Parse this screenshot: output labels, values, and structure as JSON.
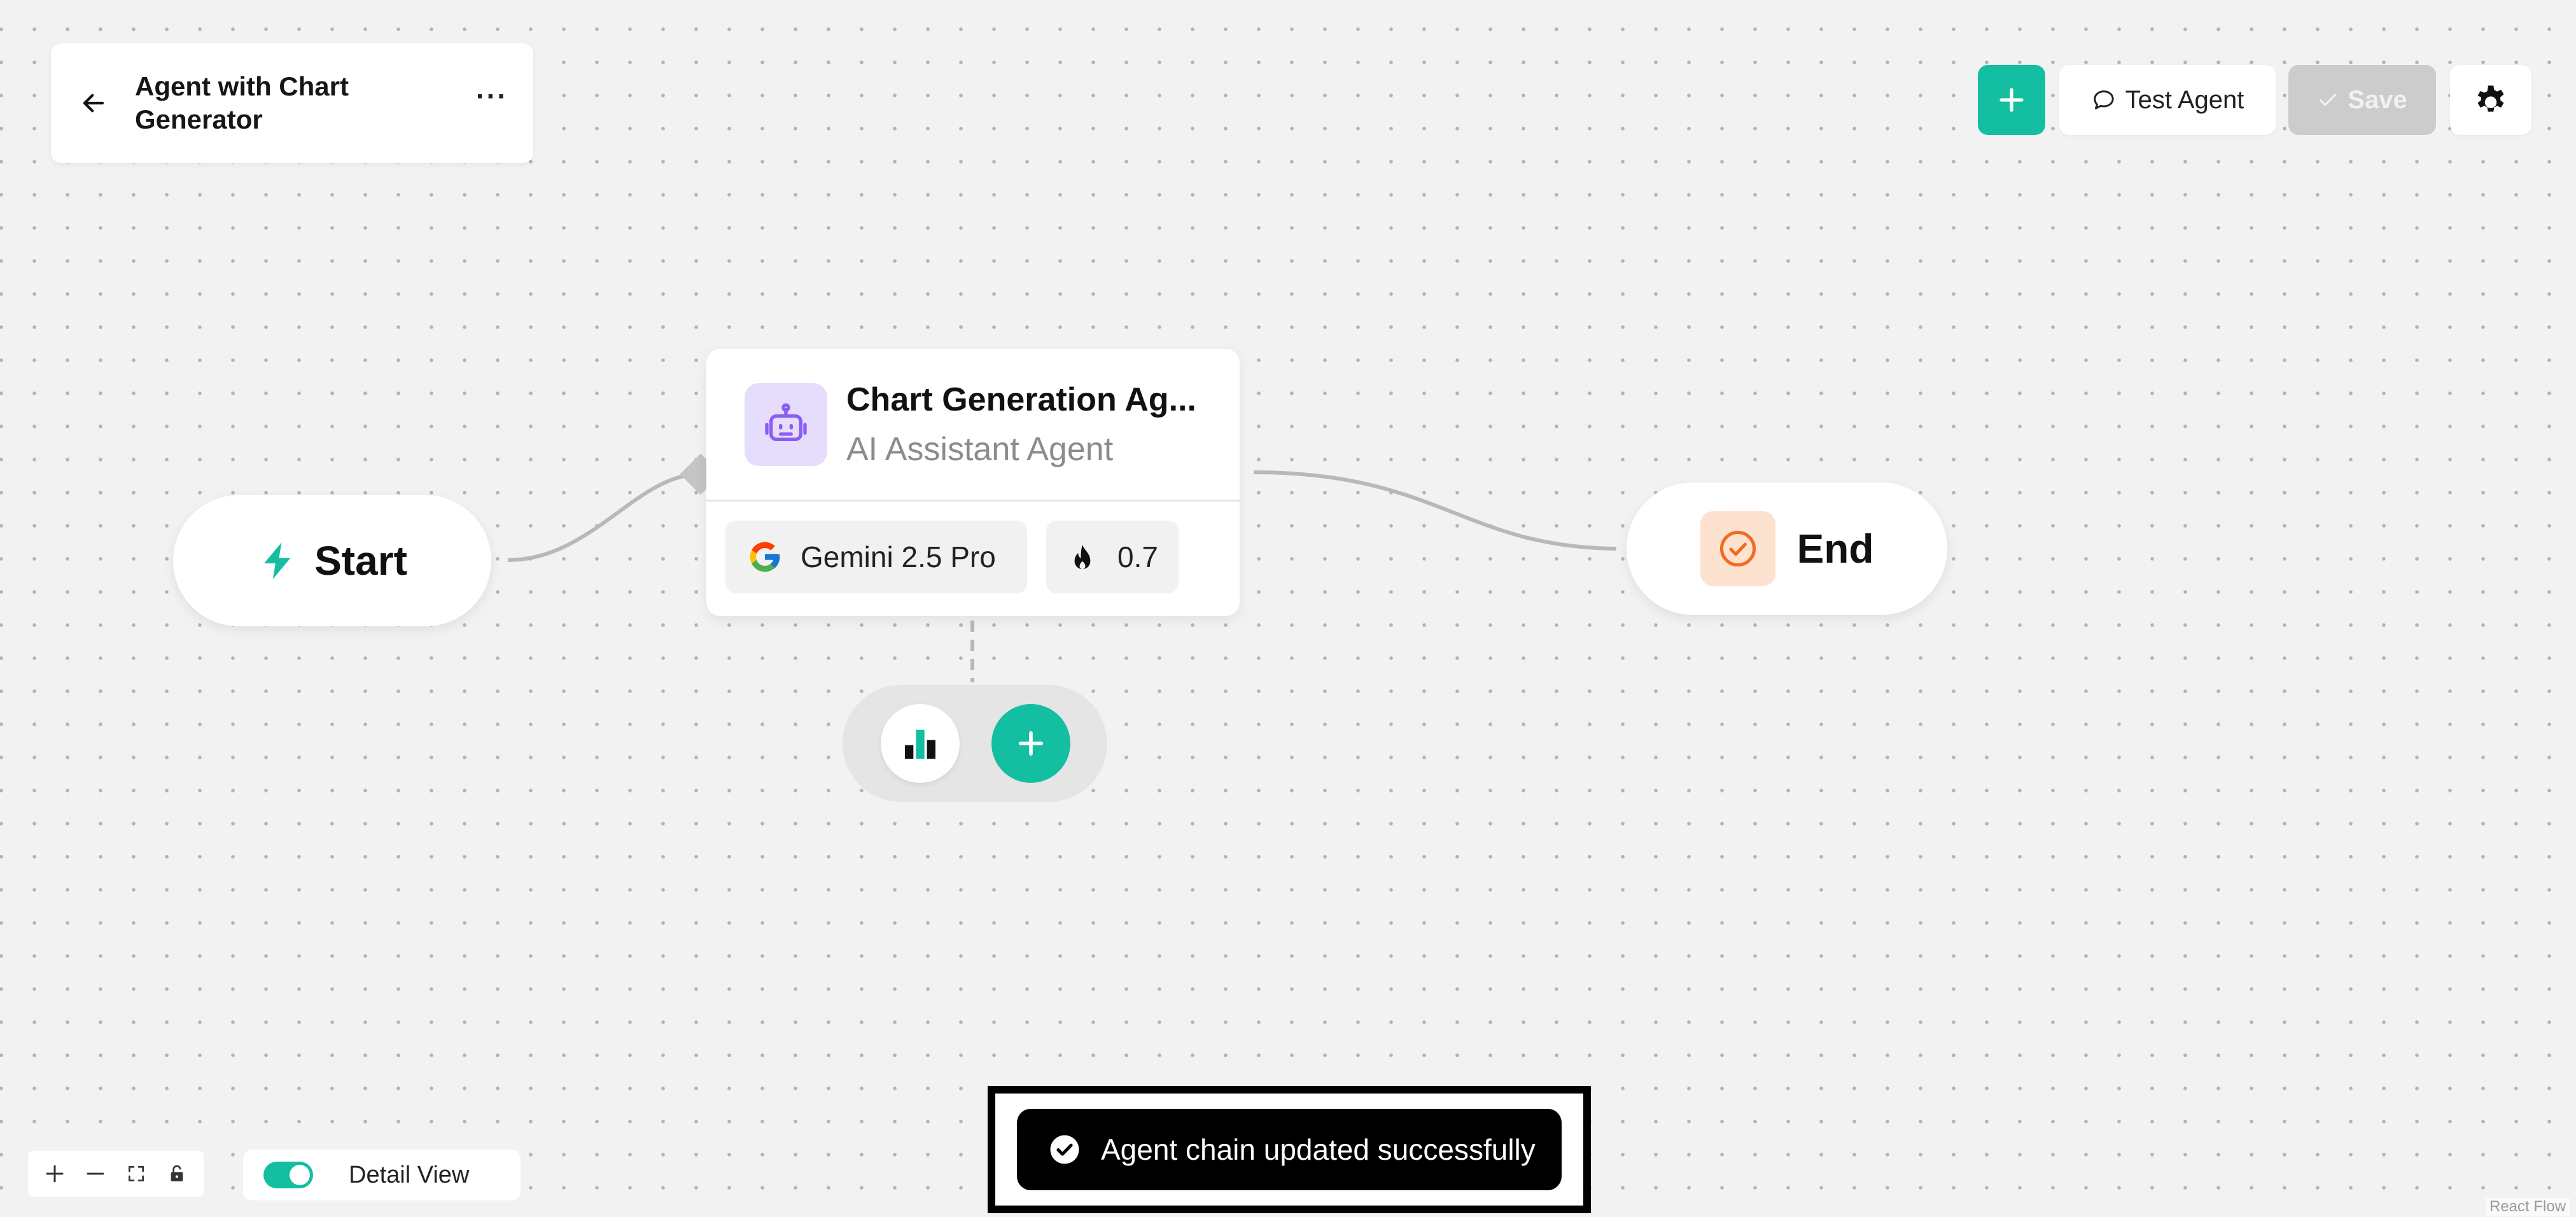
{
  "header": {
    "title": "Agent with Chart Generator",
    "more_label": "···"
  },
  "toolbar": {
    "test_label": "Test Agent",
    "save_label": "Save"
  },
  "nodes": {
    "start": {
      "label": "Start"
    },
    "agent": {
      "title": "Chart Generation Ag...",
      "subtitle": "AI Assistant Agent",
      "model": "Gemini 2.5 Pro",
      "temperature": "0.7"
    },
    "end": {
      "label": "End"
    }
  },
  "controls": {
    "detail_view_label": "Detail View",
    "detail_view_on": true
  },
  "toast": {
    "message": "Agent chain updated successfully"
  },
  "attribution": "React Flow",
  "colors": {
    "accent": "#13bfa0",
    "agent_icon_bg": "#e6dcfb",
    "agent_icon": "#8b5cf6",
    "end_icon_bg": "#fde2cf",
    "end_icon": "#f26b21",
    "save_disabled": "#cccccc"
  },
  "icons": {
    "back": "arrow-left-icon",
    "add": "plus-icon",
    "test": "chat-bubble-icon",
    "save": "check-icon",
    "settings": "gear-icon",
    "start": "lightning-bolt-icon",
    "agent": "robot-icon",
    "model": "google-logo-icon",
    "temperature": "flame-icon",
    "end": "check-circle-icon",
    "tool": "bar-chart-icon"
  }
}
